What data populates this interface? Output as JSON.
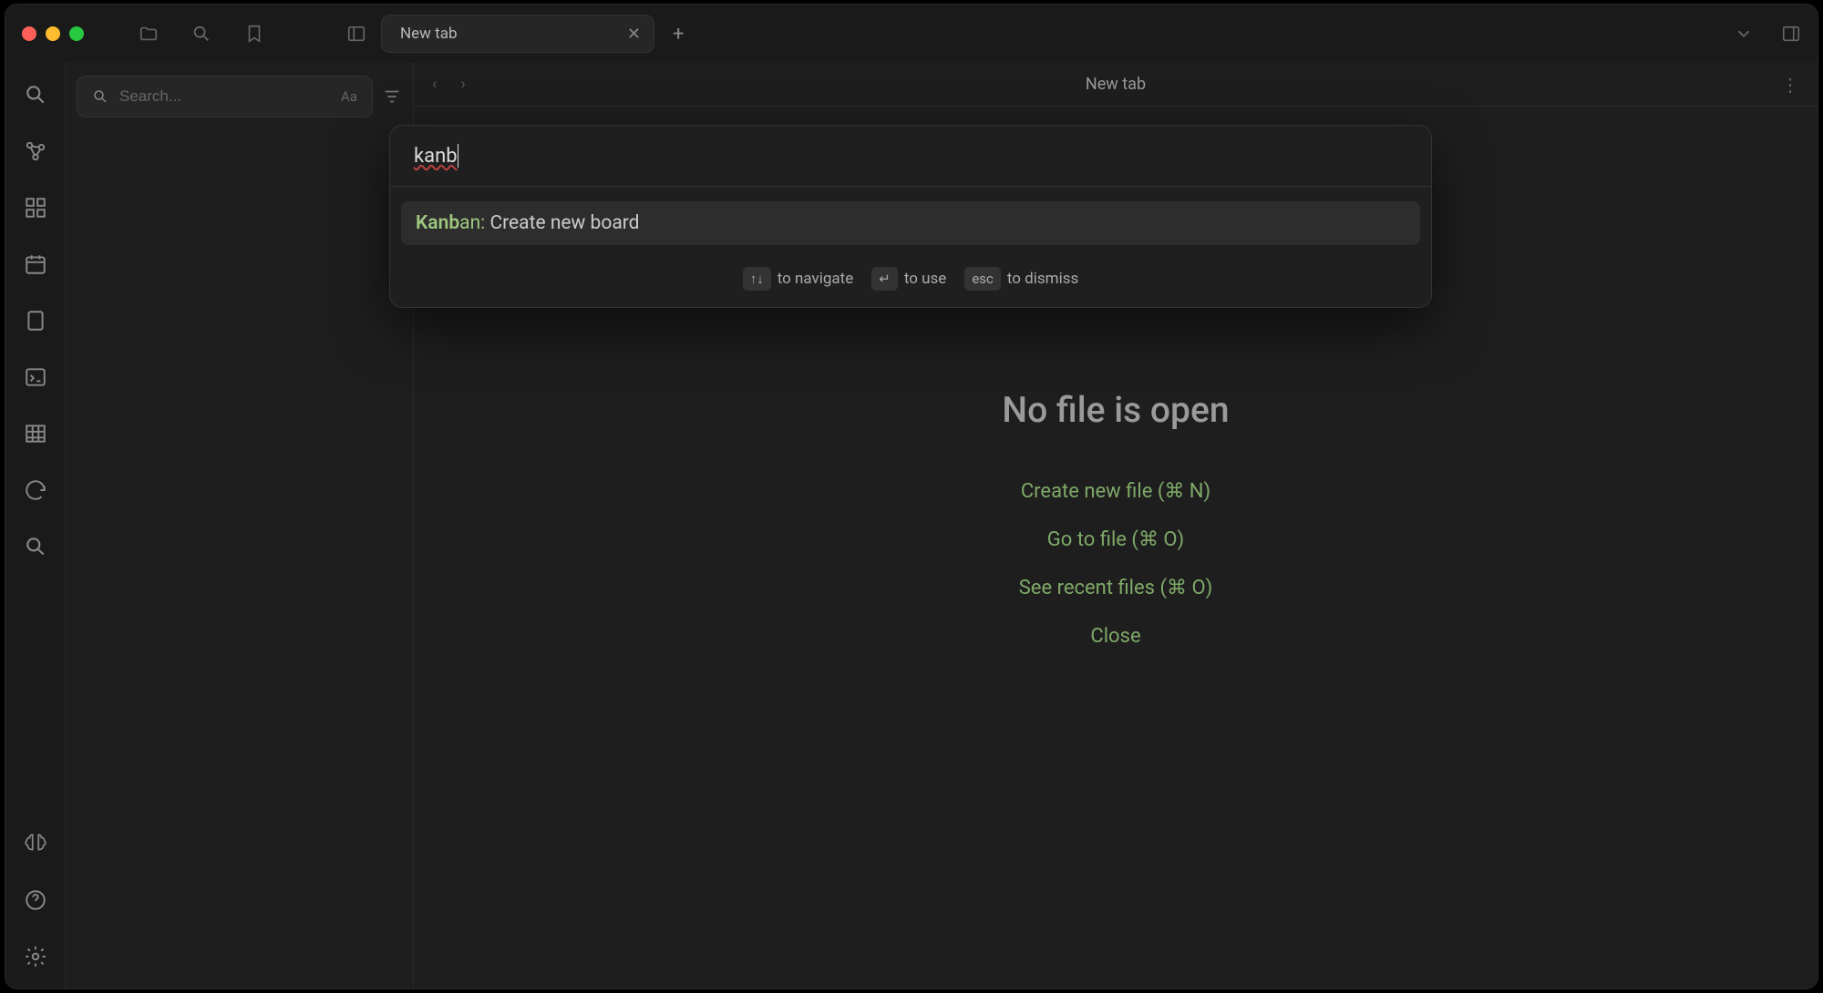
{
  "tab": {
    "title": "New tab"
  },
  "main": {
    "title": "New tab"
  },
  "sidebar": {
    "search_placeholder": "Search..."
  },
  "empty": {
    "title": "No file is open",
    "actions": {
      "create": "Create new file (⌘ N)",
      "goto": "Go to file (⌘ O)",
      "recent": "See recent files (⌘ O)",
      "close": "Close"
    }
  },
  "palette": {
    "input": "kanb",
    "result": {
      "match_bold": "Kanb",
      "match_rest": "an:",
      "desc": " Create new board"
    },
    "hints": {
      "nav_keys": "↑↓",
      "nav_label": "to navigate",
      "use_keys": "↵",
      "use_label": "to use",
      "dismiss_keys": "esc",
      "dismiss_label": "to dismiss"
    }
  }
}
